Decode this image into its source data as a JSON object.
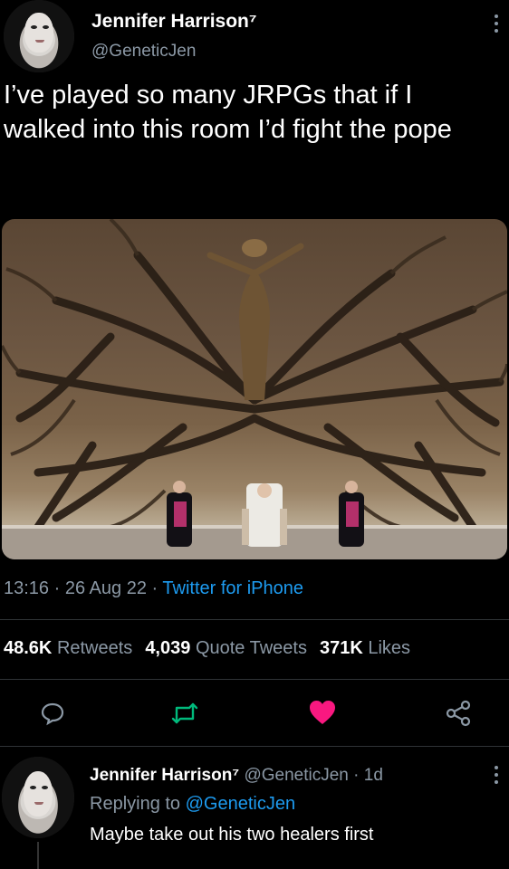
{
  "tweet": {
    "author_name": "Jennifer Harrison⁷",
    "handle": "@GeneticJen",
    "text": "I’ve played so many JRPGs that if I walked into this room I’d fight the pope",
    "time": "13:16",
    "date": "26 Aug 22",
    "source": "Twitter for iPhone",
    "separator": "·"
  },
  "stats": {
    "retweets_count": "48.6K",
    "retweets_label": "Retweets",
    "quotes_count": "4,039",
    "quotes_label": "Quote Tweets",
    "likes_count": "371K",
    "likes_label": "Likes"
  },
  "actions": {
    "reply_icon": "reply-icon",
    "retweet_icon": "retweet-icon",
    "like_icon": "heart-icon",
    "share_icon": "share-icon",
    "like_color": "#f91880",
    "retweet_color": "#00ba7c"
  },
  "reply": {
    "author_name": "Jennifer Harrison⁷",
    "handle": "@GeneticJen",
    "age": "1d",
    "replying_prefix": "Replying to",
    "replying_to": "@GeneticJen",
    "text": "Maybe take out his two healers first"
  },
  "colors": {
    "background": "#000000",
    "secondary_text": "#8b98a5",
    "link": "#1d9bf0"
  }
}
